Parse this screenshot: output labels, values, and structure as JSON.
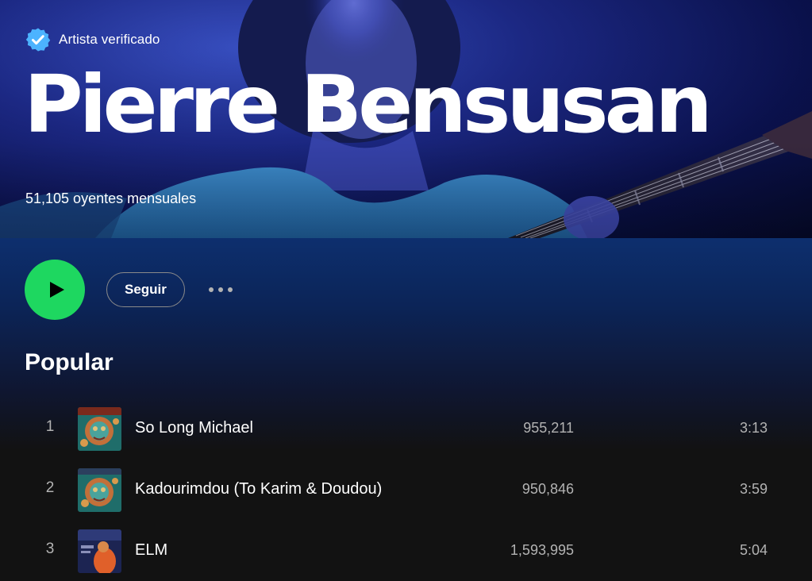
{
  "header": {
    "verified_label": "Artista verificado",
    "artist_name": "Pierre Bensusan",
    "monthly_listeners": "51,105 oyentes mensuales"
  },
  "actions": {
    "play_icon": "play-icon",
    "follow_label": "Seguir",
    "more_icon": "more-options-icon"
  },
  "popular": {
    "title": "Popular",
    "tracks": [
      {
        "number": "1",
        "title": "So Long Michael",
        "plays": "955,211",
        "duration": "3:13"
      },
      {
        "number": "2",
        "title": "Kadourimdou (To Karim & Doudou)",
        "plays": "950,846",
        "duration": "3:59"
      },
      {
        "number": "3",
        "title": "ELM",
        "plays": "1,593,995",
        "duration": "5:04"
      }
    ]
  },
  "colors": {
    "accent_green": "#1ed760",
    "verified_blue": "#4cb3ff",
    "background": "#121212",
    "hero_blue": "#1d2a8a"
  }
}
